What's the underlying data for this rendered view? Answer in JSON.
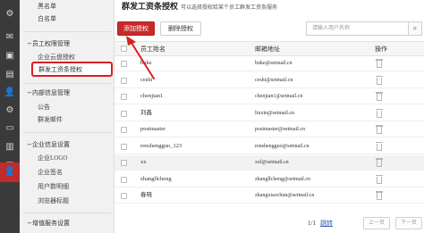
{
  "rail": {
    "icons": [
      {
        "name": "gear-icon",
        "glyph": "⚙"
      },
      {
        "name": "mail-icon",
        "glyph": "✉"
      },
      {
        "name": "contact-card-icon",
        "glyph": "▣"
      },
      {
        "name": "document-icon",
        "glyph": "▤"
      },
      {
        "name": "user-icon",
        "glyph": "👤"
      },
      {
        "name": "settings-circle-icon",
        "glyph": "⚙"
      },
      {
        "name": "monitor-icon",
        "glyph": "▭"
      },
      {
        "name": "address-book-icon",
        "glyph": "▥"
      },
      {
        "name": "folder-icon",
        "glyph": "▦"
      },
      {
        "name": "admin-user-icon",
        "glyph": "👤"
      }
    ]
  },
  "sidebar": {
    "top_items": [
      "黑名单",
      "白名单"
    ],
    "group1": {
      "title": "员工权限管理",
      "items": [
        "企业云盘授权",
        "群发工资条授权"
      ]
    },
    "group2": {
      "title": "内部信息管理",
      "items": [
        "公告",
        "群发邮件"
      ]
    },
    "group3": {
      "title": "企业信息设置",
      "items": [
        "企业LOGO",
        "企业签名",
        "用户数明细",
        "浏览器标题"
      ]
    },
    "group4": {
      "title": "增值服务设置"
    }
  },
  "page": {
    "title": "群发工资条授权",
    "desc": "可以选择授权给某个员工群发工资条服务"
  },
  "toolbar": {
    "add_label": "添加授权",
    "delete_label": "删除授权",
    "search_placeholder": "请输入用户名称"
  },
  "table": {
    "headers": [
      "员工姓名",
      "邮箱地址",
      "操作"
    ],
    "rows": [
      {
        "name": "buke",
        "email": "buke@setmail.cn"
      },
      {
        "name": "ceshi",
        "email": "ceshi@setmail.cn"
      },
      {
        "name": "chenjian1",
        "email": "chenjian1@setmail.cn"
      },
      {
        "name": "刘鑫",
        "email": "liuxin@setmail.cn"
      },
      {
        "name": "postmaster",
        "email": "postmaster@setmail.cn"
      },
      {
        "name": "renshengguo_123",
        "email": "renshengguo@setmail.cn"
      },
      {
        "name": "xx",
        "email": "xxl@setmail.cn"
      },
      {
        "name": "zhangllcheng",
        "email": "zhangllcheng@setmail.cn"
      },
      {
        "name": "春晓",
        "email": "zhangxiaochun@setmail.cn"
      }
    ]
  },
  "pager": {
    "count": "1/1",
    "jump": "跳转",
    "prev": "上一页",
    "next": "下一页"
  },
  "colors": {
    "accent": "#c72a2a",
    "annotation": "#d9201c"
  }
}
